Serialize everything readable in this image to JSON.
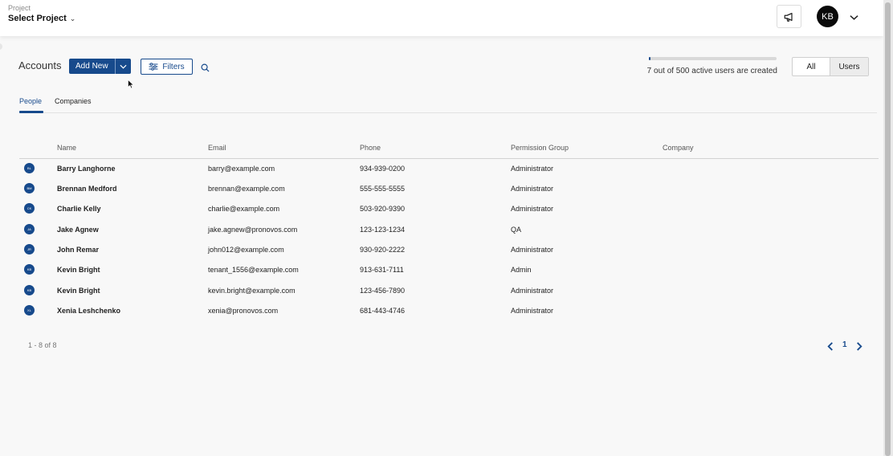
{
  "header": {
    "project_label": "Project",
    "project_value": "Select Project",
    "avatar_initials": "KB",
    "announce_icon": "megaphone-icon"
  },
  "toolbar": {
    "title": "Accounts",
    "add_new_label": "Add New",
    "filters_label": "Filters",
    "search_icon": "search-icon"
  },
  "usage": {
    "text": "7 out of 500 active users are created",
    "created": 7,
    "limit": 500
  },
  "toggle": {
    "all_label": "All",
    "users_label": "Users",
    "selected": "Users"
  },
  "tabs": [
    {
      "label": "People",
      "active": true
    },
    {
      "label": "Companies",
      "active": false
    }
  ],
  "table": {
    "columns": [
      "Name",
      "Email",
      "Phone",
      "Permission Group",
      "Company"
    ],
    "rows": [
      {
        "initials": "BL",
        "name": "Barry Langhorne",
        "email": "barry@example.com",
        "phone": "934-939-0200",
        "permission": "Administrator",
        "company": ""
      },
      {
        "initials": "BM",
        "name": "Brennan Medford",
        "email": "brennan@example.com",
        "phone": "555-555-5555",
        "permission": "Administrator",
        "company": ""
      },
      {
        "initials": "CK",
        "name": "Charlie Kelly",
        "email": "charlie@example.com",
        "phone": "503-920-9390",
        "permission": "Administrator",
        "company": ""
      },
      {
        "initials": "JA",
        "name": "Jake Agnew",
        "email": "jake.agnew@pronovos.com",
        "phone": "123-123-1234",
        "permission": "QA",
        "company": ""
      },
      {
        "initials": "JR",
        "name": "John Remar",
        "email": "john012@example.com",
        "phone": "930-920-2222",
        "permission": "Administrator",
        "company": ""
      },
      {
        "initials": "KB",
        "name": "Kevin Bright",
        "email": "tenant_1556@example.com",
        "phone": "913-631-7111",
        "permission": "Admin",
        "company": ""
      },
      {
        "initials": "KB",
        "name": "Kevin Bright",
        "email": "kevin.bright@example.com",
        "phone": "123-456-7890",
        "permission": "Administrator",
        "company": ""
      },
      {
        "initials": "XL",
        "name": "Xenia Leshchenko",
        "email": "xenia@pronovos.com",
        "phone": "681-443-4746",
        "permission": "Administrator",
        "company": ""
      }
    ]
  },
  "pagination": {
    "range_text": "1 - 8 of 8",
    "current_page": "1"
  },
  "colors": {
    "primary": "#174a8c",
    "background": "#f8f8f8",
    "header_bg": "#ffffff"
  }
}
